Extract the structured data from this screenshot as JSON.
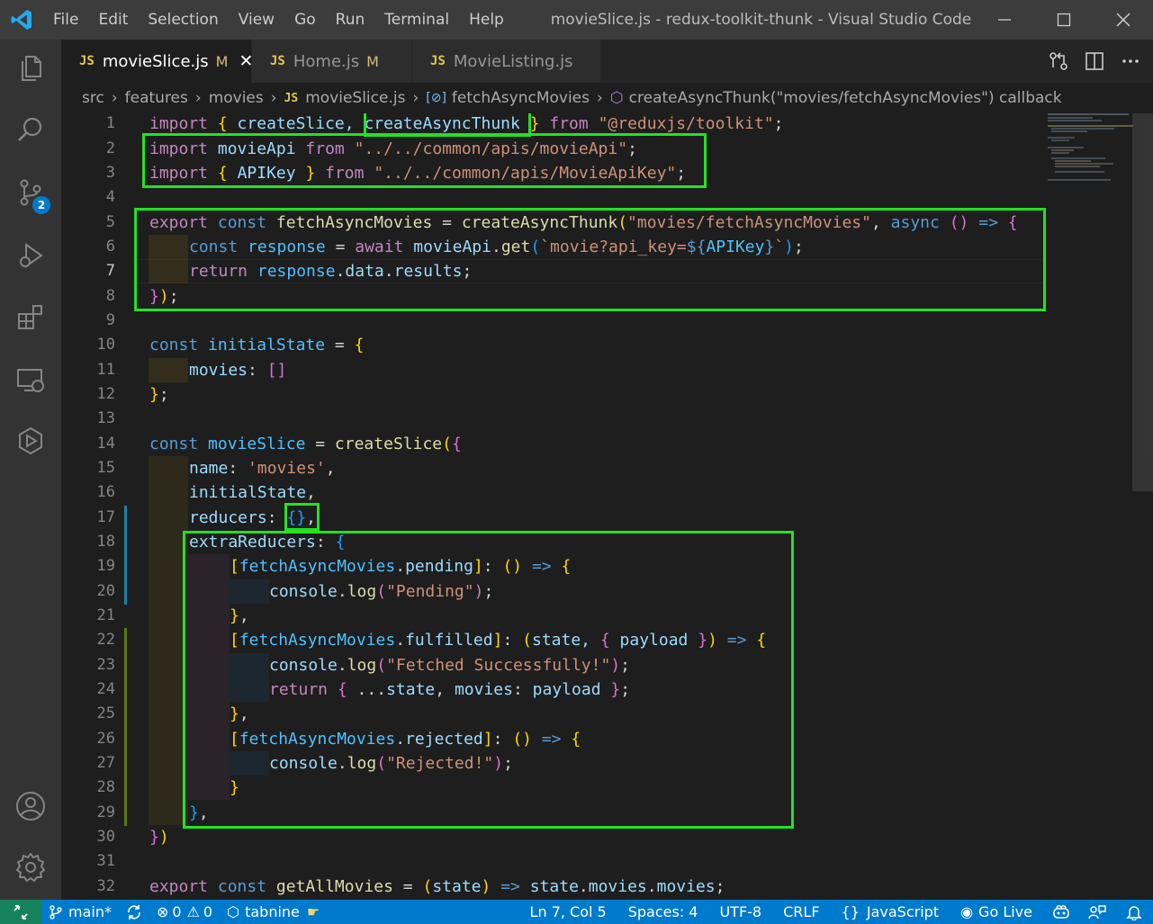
{
  "titlebar": {
    "menu": [
      "File",
      "Edit",
      "Selection",
      "View",
      "Go",
      "Run",
      "Terminal",
      "Help"
    ],
    "title": "movieSlice.js - redux-toolkit-thunk - Visual Studio Code"
  },
  "activity": {
    "scm_badge": "2"
  },
  "tabs": [
    {
      "icon": "JS",
      "label": "movieSlice.js",
      "modified": "M",
      "active": true
    },
    {
      "icon": "JS",
      "label": "Home.js",
      "modified": "M",
      "active": false
    },
    {
      "icon": "JS",
      "label": "MovieListing.js",
      "modified": "",
      "active": false
    }
  ],
  "breadcrumb": {
    "src": "src",
    "features": "features",
    "movies": "movies",
    "file_icon": "JS",
    "file": "movieSlice.js",
    "symbol": "fetchAsyncMovies",
    "callback": "createAsyncThunk(\"movies/fetchAsyncMovies\") callback"
  },
  "editor": {
    "line_numbers": [
      "1",
      "2",
      "3",
      "4",
      "5",
      "6",
      "7",
      "8",
      "9",
      "10",
      "11",
      "12",
      "13",
      "14",
      "15",
      "16",
      "17",
      "18",
      "19",
      "20",
      "21",
      "22",
      "23",
      "24",
      "25",
      "26",
      "27",
      "28",
      "29",
      "30",
      "31",
      "32"
    ],
    "current_line": 7,
    "code": {
      "l1": [
        "import",
        " ",
        "{",
        " createSlice, ",
        "createAsyncThunk",
        " ",
        "}",
        " ",
        "from",
        " ",
        "\"@reduxjs/toolkit\"",
        ";"
      ],
      "l2": [
        "import",
        " ",
        "movieApi",
        " ",
        "from",
        " ",
        "\"../../common/apis/movieApi\"",
        ";"
      ],
      "l3": [
        "import",
        " ",
        "{",
        " ",
        "APIKey",
        " ",
        "}",
        " ",
        "from",
        " ",
        "\"../../common/apis/MovieApiKey\"",
        ";"
      ],
      "l5": [
        "export",
        " ",
        "const",
        " ",
        "fetchAsyncMovies",
        " = ",
        "createAsyncThunk",
        "(",
        "\"movies/fetchAsyncMovies\"",
        ", ",
        "async",
        " ",
        "()",
        " ",
        "=>",
        " ",
        "{"
      ],
      "l6": [
        "const",
        " ",
        "response",
        " = ",
        "await",
        " ",
        "movieApi",
        ".",
        "get",
        "(",
        "`movie?api_key=",
        "${",
        "APIKey",
        "}",
        "`",
        ")",
        ";"
      ],
      "l7": [
        "return",
        " ",
        "response",
        ".",
        "data",
        ".",
        "results",
        ";"
      ],
      "l8": [
        "}",
        ")",
        ";"
      ],
      "l10": [
        "const",
        " ",
        "initialState",
        " = ",
        "{"
      ],
      "l11": [
        "movies",
        ": ",
        "[]"
      ],
      "l12": [
        "}",
        ";"
      ],
      "l14": [
        "const",
        " ",
        "movieSlice",
        " = ",
        "createSlice",
        "(",
        "{"
      ],
      "l15": [
        "name",
        ": ",
        "'movies'",
        ","
      ],
      "l16": [
        "initialState",
        ","
      ],
      "l17": [
        "reducers",
        ": ",
        "{}",
        ","
      ],
      "l18": [
        "extraReducers",
        ": ",
        "{"
      ],
      "l19": [
        "[",
        "fetchAsyncMovies",
        ".",
        "pending",
        "]",
        ": ",
        "()",
        " ",
        "=>",
        " ",
        "{"
      ],
      "l20": [
        "console",
        ".",
        "log",
        "(",
        "\"Pending\"",
        ")",
        ";"
      ],
      "l21": [
        "}",
        ","
      ],
      "l22": [
        "[",
        "fetchAsyncMovies",
        ".",
        "fulfilled",
        "]",
        ": ",
        "(",
        "state, ",
        "{",
        " payload ",
        "}",
        ")",
        " ",
        "=>",
        " ",
        "{"
      ],
      "l23": [
        "console",
        ".",
        "log",
        "(",
        "\"Fetched Successfully!\"",
        ")",
        ";"
      ],
      "l24": [
        "return",
        " ",
        "{",
        " ...",
        "state",
        ", ",
        "movies",
        ": ",
        "payload",
        " ",
        "}",
        ";"
      ],
      "l25": [
        "}",
        ","
      ],
      "l26": [
        "[",
        "fetchAsyncMovies",
        ".",
        "rejected",
        "]",
        ": ",
        "()",
        " ",
        "=>",
        " ",
        "{"
      ],
      "l27": [
        "console",
        ".",
        "log",
        "(",
        "\"Rejected!\"",
        ")",
        ";"
      ],
      "l28": [
        "}"
      ],
      "l29": [
        "}",
        ","
      ],
      "l30": [
        "}",
        ")"
      ],
      "l32": [
        "export",
        " ",
        "const",
        " ",
        "getAllMovies",
        " = ",
        "(",
        "state",
        ")",
        " ",
        "=>",
        " ",
        "state",
        ".",
        "movies",
        ".",
        "movies",
        ";"
      ]
    }
  },
  "statusbar": {
    "branch": "main*",
    "errors": "0",
    "warnings": "0",
    "tabnine": "tabnine",
    "position": "Ln 7, Col 5",
    "spaces": "Spaces: 4",
    "encoding": "UTF-8",
    "eol": "CRLF",
    "language": "JavaScript",
    "golive": "Go Live"
  },
  "colors": {
    "highlight": "#22e222",
    "status": "#007acc",
    "remote": "#16825d"
  }
}
